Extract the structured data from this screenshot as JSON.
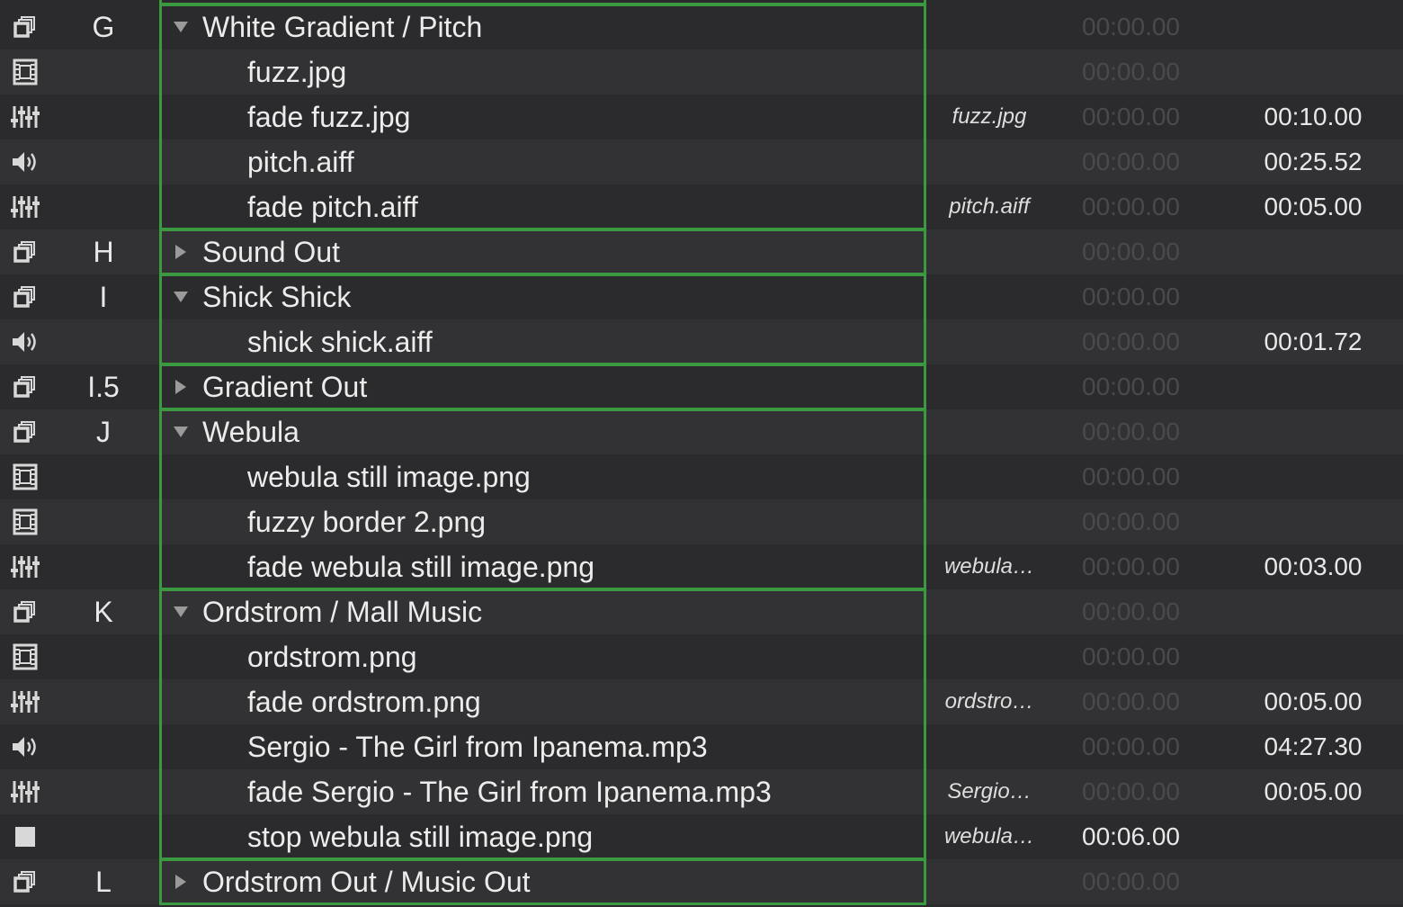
{
  "colors": {
    "background_odd": "#2b2b2d",
    "background_even": "#323234",
    "group_border": "#3b9a3f",
    "text": "#ececec",
    "dim_text": "#4a4a4c"
  },
  "rows": [
    {
      "icon": "group-icon",
      "number": "G",
      "name": "White Gradient / Pitch",
      "level": "group",
      "expanded": true,
      "target": "",
      "prewait": "00:00.00",
      "prewait_active": false,
      "duration": ""
    },
    {
      "icon": "film-icon",
      "number": "",
      "name": "fuzz.jpg",
      "level": "child",
      "target": "",
      "prewait": "00:00.00",
      "prewait_active": false,
      "duration": ""
    },
    {
      "icon": "fade-icon",
      "number": "",
      "name": "fade fuzz.jpg",
      "level": "child",
      "target": "fuzz.jpg",
      "prewait": "00:00.00",
      "prewait_active": false,
      "duration": "00:10.00"
    },
    {
      "icon": "speaker-icon",
      "number": "",
      "name": "pitch.aiff",
      "level": "child",
      "target": "",
      "prewait": "00:00.00",
      "prewait_active": false,
      "duration": "00:25.52"
    },
    {
      "icon": "fade-icon",
      "number": "",
      "name": "fade pitch.aiff",
      "level": "child",
      "target": "pitch.aiff",
      "prewait": "00:00.00",
      "prewait_active": false,
      "duration": "00:05.00"
    },
    {
      "icon": "group-icon",
      "number": "H",
      "name": "Sound Out",
      "level": "group",
      "expanded": false,
      "target": "",
      "prewait": "00:00.00",
      "prewait_active": false,
      "duration": ""
    },
    {
      "icon": "group-icon",
      "number": "I",
      "name": "Shick Shick",
      "level": "group",
      "expanded": true,
      "target": "",
      "prewait": "00:00.00",
      "prewait_active": false,
      "duration": ""
    },
    {
      "icon": "speaker-icon",
      "number": "",
      "name": "shick shick.aiff",
      "level": "child",
      "target": "",
      "prewait": "00:00.00",
      "prewait_active": false,
      "duration": "00:01.72"
    },
    {
      "icon": "group-icon",
      "number": "I.5",
      "name": "Gradient Out",
      "level": "group",
      "expanded": false,
      "target": "",
      "prewait": "00:00.00",
      "prewait_active": false,
      "duration": ""
    },
    {
      "icon": "group-icon",
      "number": "J",
      "name": "Webula",
      "level": "group",
      "expanded": true,
      "target": "",
      "prewait": "00:00.00",
      "prewait_active": false,
      "duration": ""
    },
    {
      "icon": "film-icon",
      "number": "",
      "name": "webula still image.png",
      "level": "child",
      "target": "",
      "prewait": "00:00.00",
      "prewait_active": false,
      "duration": ""
    },
    {
      "icon": "film-icon",
      "number": "",
      "name": "fuzzy border 2.png",
      "level": "child",
      "target": "",
      "prewait": "00:00.00",
      "prewait_active": false,
      "duration": ""
    },
    {
      "icon": "fade-icon",
      "number": "",
      "name": "fade webula still image.png",
      "level": "child",
      "target": "webula…",
      "prewait": "00:00.00",
      "prewait_active": false,
      "duration": "00:03.00"
    },
    {
      "icon": "group-icon",
      "number": "K",
      "name": "Ordstrom / Mall Music",
      "level": "group",
      "expanded": true,
      "target": "",
      "prewait": "00:00.00",
      "prewait_active": false,
      "duration": ""
    },
    {
      "icon": "film-icon",
      "number": "",
      "name": "ordstrom.png",
      "level": "child",
      "target": "",
      "prewait": "00:00.00",
      "prewait_active": false,
      "duration": ""
    },
    {
      "icon": "fade-icon",
      "number": "",
      "name": "fade ordstrom.png",
      "level": "child",
      "target": "ordstro…",
      "prewait": "00:00.00",
      "prewait_active": false,
      "duration": "00:05.00"
    },
    {
      "icon": "speaker-icon",
      "number": "",
      "name": "Sergio - The Girl from Ipanema.mp3",
      "level": "child",
      "target": "",
      "prewait": "00:00.00",
      "prewait_active": false,
      "duration": "04:27.30"
    },
    {
      "icon": "fade-icon",
      "number": "",
      "name": "fade Sergio - The Girl from Ipanema.mp3",
      "level": "child",
      "target": "Sergio…",
      "prewait": "00:00.00",
      "prewait_active": false,
      "duration": "00:05.00"
    },
    {
      "icon": "stop-icon",
      "number": "",
      "name": "stop webula still image.png",
      "level": "child",
      "target": "webula…",
      "prewait": "00:06.00",
      "prewait_active": true,
      "duration": ""
    },
    {
      "icon": "group-icon",
      "number": "L",
      "name": "Ordstrom Out / Music Out",
      "level": "group",
      "expanded": false,
      "target": "",
      "prewait": "00:00.00",
      "prewait_active": false,
      "duration": ""
    }
  ]
}
